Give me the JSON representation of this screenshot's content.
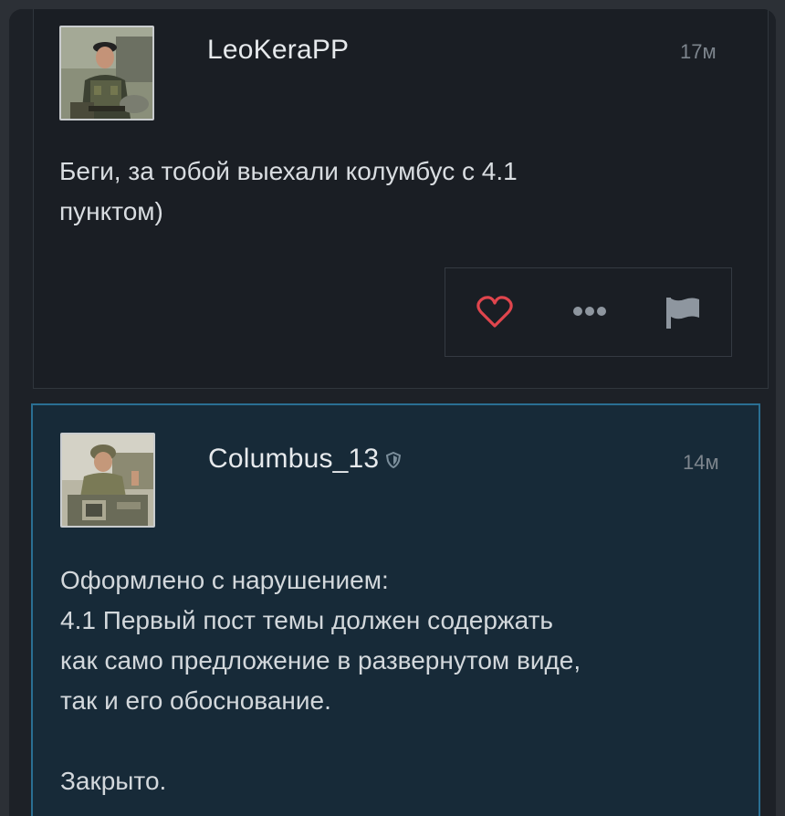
{
  "posts": [
    {
      "author": "LeoKeraPP",
      "time": "17м",
      "body": [
        "Беги, за тобой выехали колумбус с 4.1",
        "пунктом)"
      ],
      "actions": {
        "like_icon": "heart-icon",
        "more_icon": "more-dots-icon",
        "report_icon": "flag-icon"
      }
    },
    {
      "author": "Columbus_13",
      "time": "14м",
      "badge_icon": "shield-icon",
      "body": [
        "Оформлено с нарушением:",
        "4.1 Первый пост темы должен содержать",
        "как само предложение в развернутом виде,",
        "так и его обоснование.",
        "",
        "Закрыто."
      ]
    }
  ],
  "colors": {
    "background": "#1a1e24",
    "highlight_post": "#172a38",
    "highlight_border": "#2a6f93",
    "like_red": "#e0454d",
    "icon_gray": "#8e969f"
  }
}
